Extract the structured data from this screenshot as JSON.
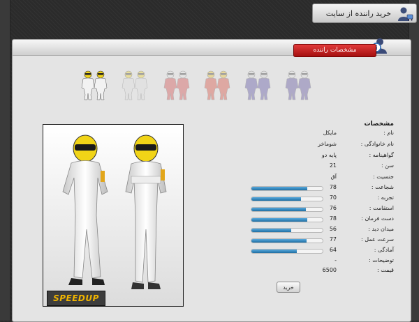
{
  "header": {
    "title": "خرید راننده از سایت",
    "icon": "user-cart-icon"
  },
  "section": {
    "tab_label": "مشخصات راننده",
    "info_icon": "info-icon"
  },
  "thumbnails": [
    {
      "suit_color": "#f2f2f2",
      "helmet_color": "#f2d51e",
      "state": "selected"
    },
    {
      "suit_color": "#dcdcdc",
      "helmet_color": "#f2d51e",
      "state": "faded"
    },
    {
      "suit_color": "#d03a3a",
      "helmet_color": "#e9e9e9",
      "state": "faded"
    },
    {
      "suit_color": "#d53c2a",
      "helmet_color": "#f0c21a",
      "state": "faded"
    },
    {
      "suit_color": "#4a3f9a",
      "helmet_color": "#d9d9d9",
      "state": "faded"
    },
    {
      "suit_color": "#4b3e94",
      "helmet_color": "#e6e6e6",
      "state": "faded"
    }
  ],
  "photo": {
    "logo_text": "SPEEDUP"
  },
  "specs": {
    "title": "مشخصات",
    "rows": [
      {
        "label": "نام :",
        "value": "مایکل"
      },
      {
        "label": "نام خانوادگی :",
        "value": "شوماخر"
      },
      {
        "label": "گواهینامه :",
        "value": "پایه دو"
      },
      {
        "label": "سن :",
        "value": "21"
      },
      {
        "label": "جنسیت :",
        "value": "آق"
      },
      {
        "label": "شجاعت :",
        "value": "78",
        "level": 0.78
      },
      {
        "label": "تجربه :",
        "value": "70",
        "level": 0.7
      },
      {
        "label": "استقامت :",
        "value": "76",
        "level": 0.76
      },
      {
        "label": "دست فرمان :",
        "value": "78",
        "level": 0.78
      },
      {
        "label": "میدان دید :",
        "value": "56",
        "level": 0.56
      },
      {
        "label": "سرعت عمل :",
        "value": "77",
        "level": 0.77
      },
      {
        "label": "آمادگی :",
        "value": "64",
        "level": 0.64
      },
      {
        "label": "توضیحات :",
        "value": "-"
      },
      {
        "label": "قیمت :",
        "value": "6500"
      }
    ]
  },
  "buy_button": {
    "label": "خرید"
  },
  "colors": {
    "accent_red": "#c41e1e",
    "bar_blue": "#2d7fb8",
    "panel_gray": "#e4e4e4"
  }
}
